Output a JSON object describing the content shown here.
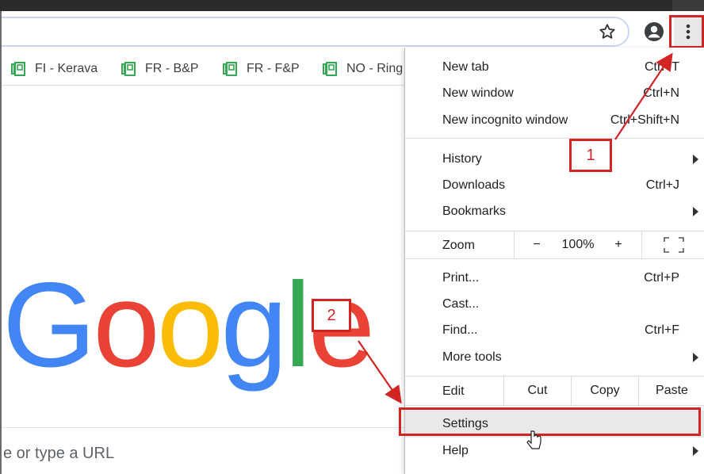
{
  "bookmarks": [
    {
      "label": "FI - Kerava"
    },
    {
      "label": "FR - B&P"
    },
    {
      "label": "FR - F&P"
    },
    {
      "label": "NO - Ring"
    }
  ],
  "page": {
    "logo": {
      "G": "G",
      "o1": "o",
      "o2": "o",
      "g": "g",
      "l": "l",
      "e": "e"
    },
    "search_placeholder": "e or type a URL"
  },
  "menu": {
    "new_tab": {
      "label": "New tab",
      "shortcut": "Ctrl+T"
    },
    "new_window": {
      "label": "New window",
      "shortcut": "Ctrl+N"
    },
    "new_incognito": {
      "label": "New incognito window",
      "shortcut": "Ctrl+Shift+N"
    },
    "history": {
      "label": "History"
    },
    "downloads": {
      "label": "Downloads",
      "shortcut": "Ctrl+J"
    },
    "bookmarks": {
      "label": "Bookmarks"
    },
    "zoom": {
      "label": "Zoom",
      "minus": "−",
      "level": "100%",
      "plus": "+"
    },
    "print": {
      "label": "Print...",
      "shortcut": "Ctrl+P"
    },
    "cast": {
      "label": "Cast..."
    },
    "find": {
      "label": "Find...",
      "shortcut": "Ctrl+F"
    },
    "more_tools": {
      "label": "More tools"
    },
    "edit": {
      "label": "Edit",
      "cut": "Cut",
      "copy": "Copy",
      "paste": "Paste"
    },
    "settings": {
      "label": "Settings"
    },
    "help": {
      "label": "Help"
    }
  },
  "annotations": {
    "step1": "1",
    "step2": "2",
    "color": "#d32424"
  }
}
